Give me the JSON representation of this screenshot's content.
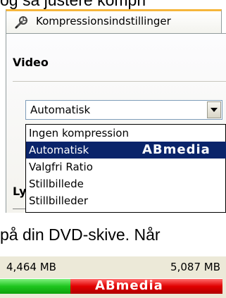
{
  "intro_text": "og så justere kompri",
  "tab": {
    "label": "Kompressionsindstillinger",
    "icon": "settings-wrench-icon"
  },
  "video_section": {
    "title": "Video",
    "select": {
      "value": "Automatisk"
    },
    "options": [
      "Ingen kompression",
      "Automatisk",
      "Valgfri Ratio",
      "Stillbillede",
      "Stillbilleder"
    ],
    "selected_index": 1,
    "watermark": "ABmedia"
  },
  "audio_section": {
    "title": "Lyd"
  },
  "body_text": "på din DVD-skive. Når",
  "capacity": {
    "used_label": "4,464 MB",
    "total_label": "5,087 MB",
    "used_value_mb": 4464,
    "total_value_mb": 5087,
    "used_color": "#1ec51e",
    "over_color": "#e00000",
    "watermark": "ABmedia"
  }
}
